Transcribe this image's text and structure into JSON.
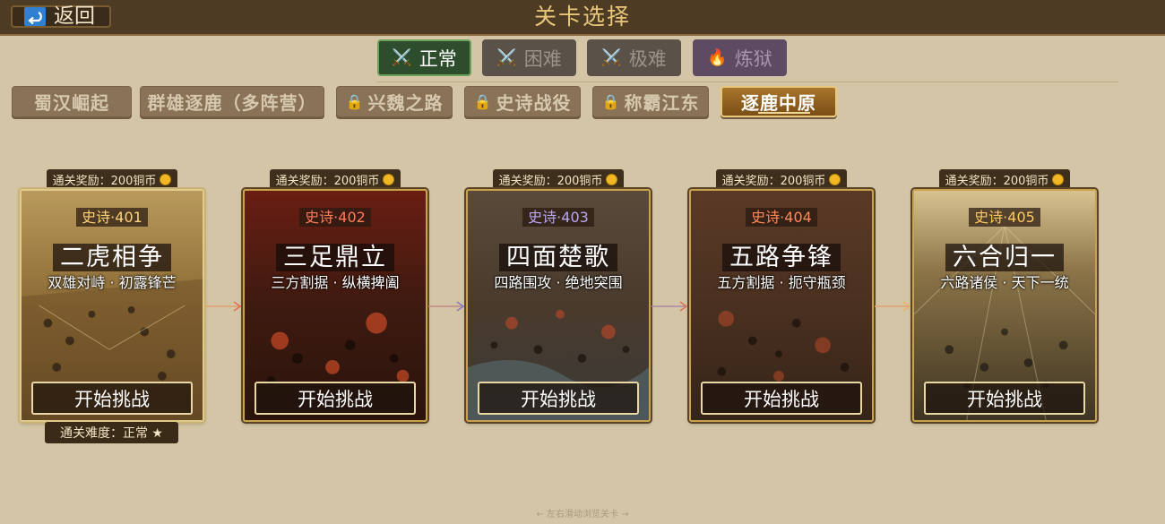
{
  "header": {
    "back_label": "返回",
    "title": "关卡选择"
  },
  "difficulty_tabs": [
    {
      "label": "正常",
      "icon": "crossed-swords-icon",
      "active": true
    },
    {
      "label": "困难",
      "icon": "crossed-swords-icon",
      "active": false
    },
    {
      "label": "极难",
      "icon": "crossed-swords-icon",
      "active": false
    },
    {
      "label": "炼狱",
      "icon": "flame-icon",
      "active": false
    }
  ],
  "campaign_tabs": [
    {
      "label": "蜀汉崛起",
      "locked": false,
      "active": false
    },
    {
      "label": "群雄逐鹿（多阵营）",
      "locked": false,
      "active": false
    },
    {
      "label": "兴魏之路",
      "locked": true,
      "active": false
    },
    {
      "label": "史诗战役",
      "locked": true,
      "active": false
    },
    {
      "label": "称霸江东",
      "locked": true,
      "active": false
    },
    {
      "label": "逐鹿中原",
      "locked": false,
      "active": true
    }
  ],
  "stages": [
    {
      "reward": "通关奖励：200铜币",
      "code": "史诗·401",
      "name": "二虎相争",
      "subtitle": "双雄对峙 · 初露锋芒",
      "button": "开始挑战",
      "code_color": "#ffd37a"
    },
    {
      "reward": "通关奖励：200铜币",
      "code": "史诗·402",
      "name": "三足鼎立",
      "subtitle": "三方割据 · 纵横捭阖",
      "button": "开始挑战",
      "code_color": "#ff7b5a"
    },
    {
      "reward": "通关奖励：200铜币",
      "code": "史诗·403",
      "name": "四面楚歌",
      "subtitle": "四路围攻 · 绝地突围",
      "button": "开始挑战",
      "code_color": "#b8a8f0"
    },
    {
      "reward": "通关奖励：200铜币",
      "code": "史诗·404",
      "name": "五路争锋",
      "subtitle": "五方割据 · 扼守瓶颈",
      "button": "开始挑战",
      "code_color": "#ff8a5a"
    },
    {
      "reward": "通关奖励：200铜币",
      "code": "史诗·405",
      "name": "六合归一",
      "subtitle": "六路诸侯 · 天下一统",
      "button": "开始挑战",
      "code_color": "#ffc860"
    }
  ],
  "cleared": {
    "label": "通关难度：正常 ★"
  },
  "scroll_hint": "← 左右滑动浏览关卡 →",
  "colors": {
    "accent_gold": "#e8c77a",
    "active_green": "#6aa05a",
    "coin": "#f2b724"
  }
}
